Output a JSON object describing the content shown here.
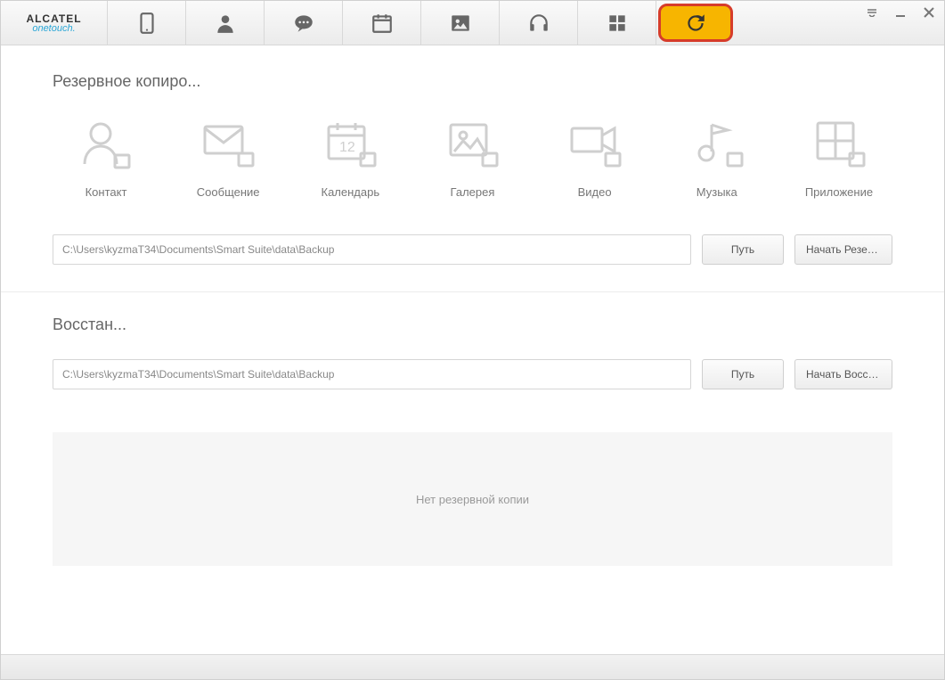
{
  "logo": {
    "line1": "ALCATEL",
    "line2": "onetouch."
  },
  "toolbar": {
    "tabs": [
      {
        "name": "phone"
      },
      {
        "name": "contacts"
      },
      {
        "name": "messages"
      },
      {
        "name": "calendar"
      },
      {
        "name": "gallery"
      },
      {
        "name": "music"
      },
      {
        "name": "apps"
      },
      {
        "name": "backup",
        "active": true
      }
    ]
  },
  "backup": {
    "title": "Резервное копиро...",
    "categories": [
      {
        "label": "Контакт"
      },
      {
        "label": "Сообщение"
      },
      {
        "label": "Календарь"
      },
      {
        "label": "Галерея"
      },
      {
        "label": "Видео"
      },
      {
        "label": "Музыка"
      },
      {
        "label": "Приложение"
      }
    ],
    "path": "C:\\Users\\kyzmaT34\\Documents\\Smart Suite\\data\\Backup",
    "path_btn": "Путь",
    "start_btn": "Начать Резервн..."
  },
  "restore": {
    "title": "Восстан...",
    "path": "C:\\Users\\kyzmaT34\\Documents\\Smart Suite\\data\\Backup",
    "path_btn": "Путь",
    "start_btn": "Начать Восстан...",
    "empty_msg": "Нет резервной копии"
  }
}
